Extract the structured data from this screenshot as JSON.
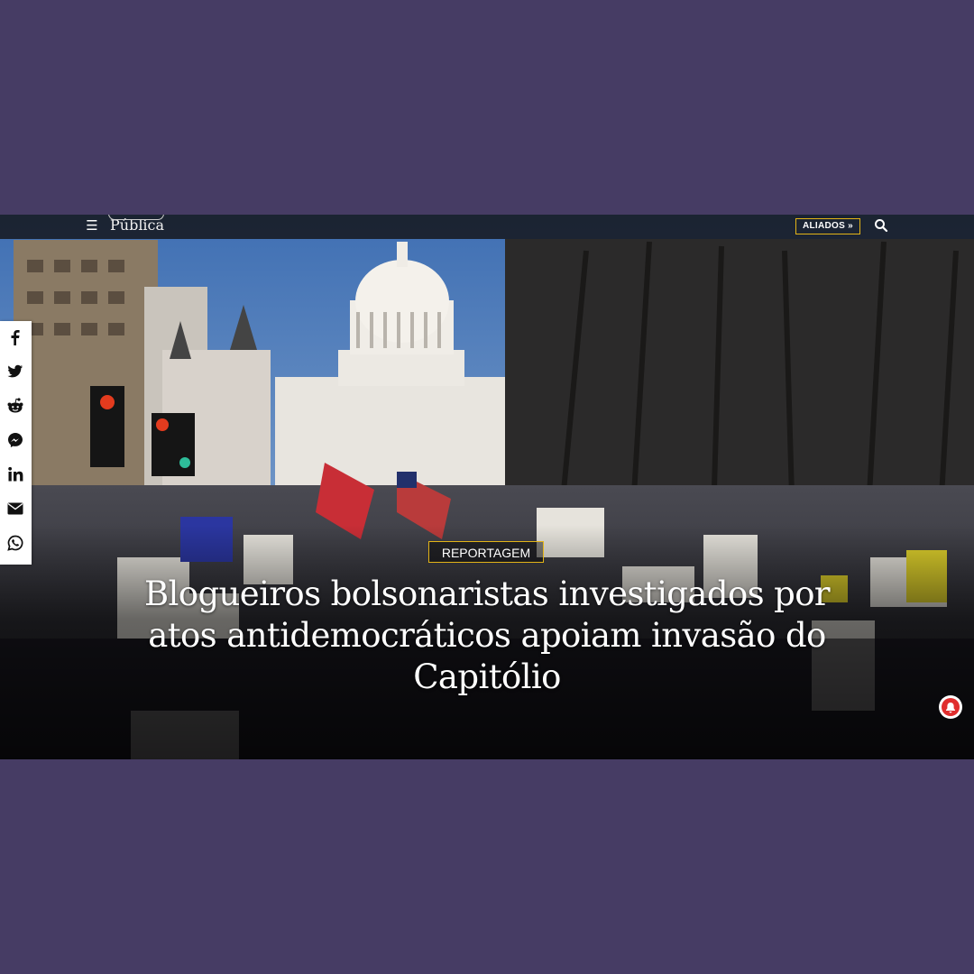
{
  "header": {
    "logo_text": "Pública",
    "aliados_label": "ALIADOS »"
  },
  "icons": {
    "menu": "hamburger-icon",
    "search": "search-icon",
    "notification": "bell-icon"
  },
  "share_bar": [
    {
      "name": "facebook-share-button",
      "icon": "facebook-icon"
    },
    {
      "name": "twitter-share-button",
      "icon": "twitter-icon"
    },
    {
      "name": "reddit-share-button",
      "icon": "reddit-icon"
    },
    {
      "name": "messenger-share-button",
      "icon": "messenger-icon"
    },
    {
      "name": "linkedin-share-button",
      "icon": "linkedin-icon"
    },
    {
      "name": "email-share-button",
      "icon": "envelope-icon"
    },
    {
      "name": "whatsapp-share-button",
      "icon": "whatsapp-icon"
    }
  ],
  "article": {
    "category": "REPORTAGEM",
    "headline": "Blogueiros bolsonaristas investigados por atos antidemocráticos apoiam invasão do Capitólio"
  },
  "colors": {
    "page_background": "#463c64",
    "accent": "#e3b417",
    "notification": "#e02d2d"
  }
}
